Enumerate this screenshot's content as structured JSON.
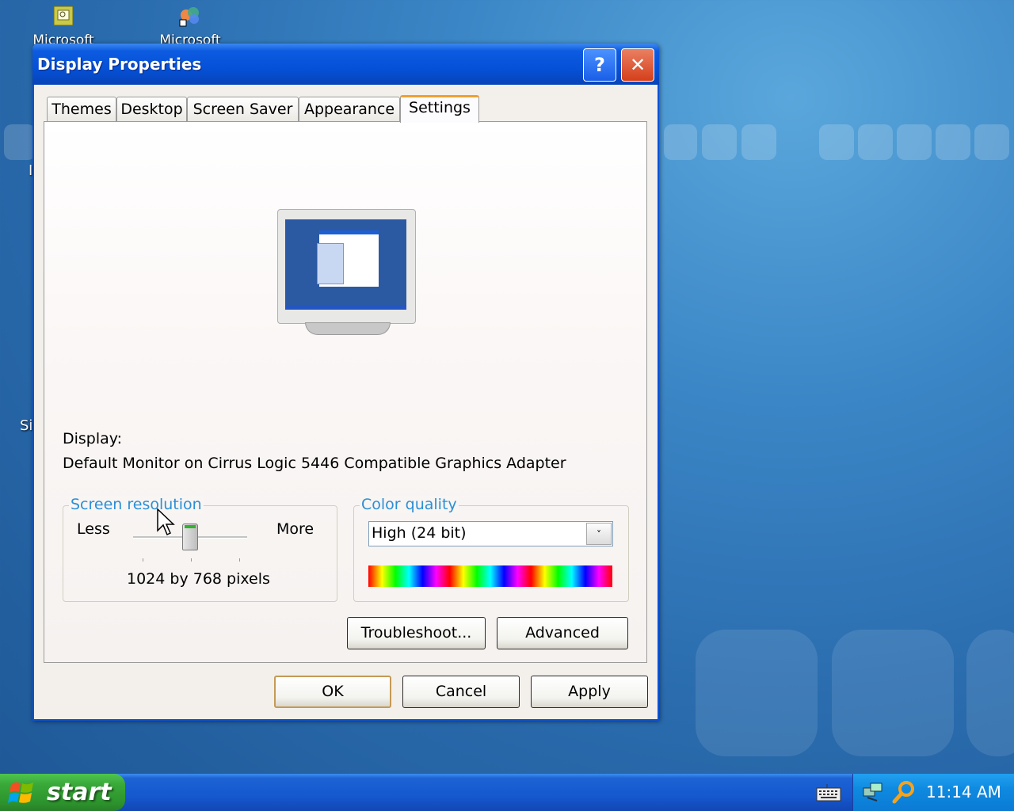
{
  "desktop": {
    "icons": [
      {
        "label": "Microsoft"
      },
      {
        "label": "Microsoft Visual"
      }
    ],
    "edge_labels": [
      "I",
      "Si"
    ]
  },
  "window": {
    "title": "Display Properties",
    "help_glyph": "?",
    "close_glyph": "✕",
    "tabs": [
      {
        "label": "Themes"
      },
      {
        "label": "Desktop"
      },
      {
        "label": "Screen Saver"
      },
      {
        "label": "Appearance"
      },
      {
        "label": "Settings"
      }
    ],
    "active_tab": "Settings",
    "display_label": "Display:",
    "display_value": "Default Monitor on Cirrus Logic 5446 Compatible Graphics Adapter",
    "resolution": {
      "title": "Screen resolution",
      "less_label": "Less",
      "more_label": "More",
      "value_text": "1024 by 768 pixels",
      "slider_position_fraction": 0.5
    },
    "color_quality": {
      "title": "Color quality",
      "selected": "High (24 bit)",
      "arrow_glyph": "˅"
    },
    "buttons": {
      "troubleshoot": "Troubleshoot...",
      "advanced": "Advanced",
      "ok": "OK",
      "cancel": "Cancel",
      "apply": "Apply"
    }
  },
  "taskbar": {
    "start_label": "start",
    "clock": "11:14 AM"
  },
  "colors": {
    "title_bar": "#0551d8",
    "close_button": "#d43f1a",
    "active_tab_accent": "#f0a030",
    "group_title": "#2b8fd6",
    "start_button": "#38a838"
  }
}
